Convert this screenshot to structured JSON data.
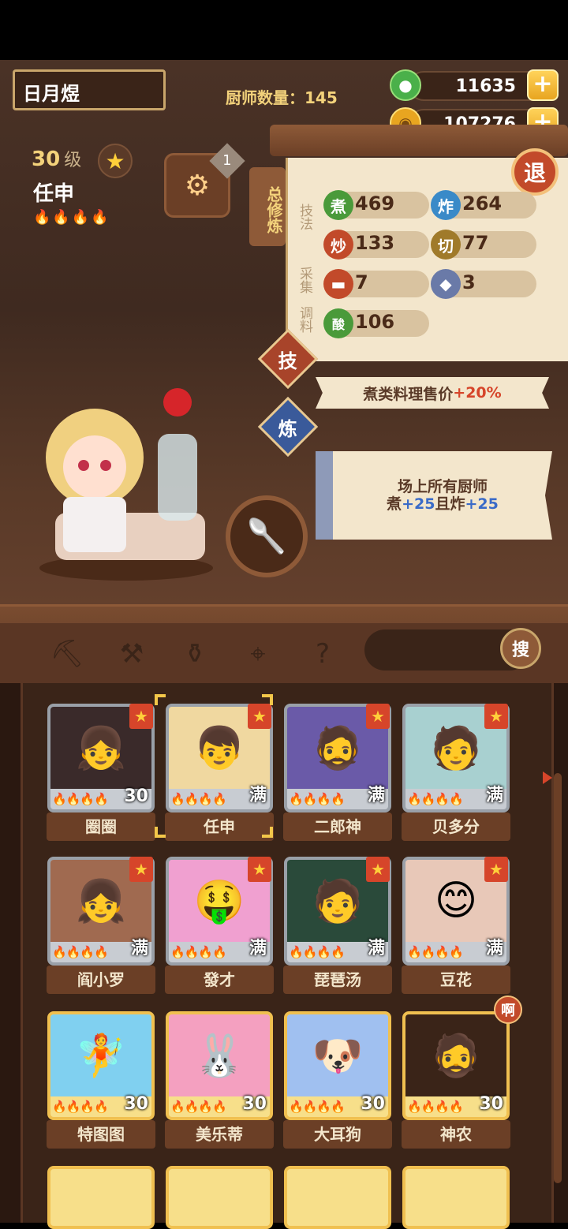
{
  "header": {
    "player_name": "日月煜",
    "chef_count_label": "厨师数量：145",
    "currency_jade": "11635",
    "currency_coin": "107276",
    "plus_label": "+"
  },
  "chef": {
    "level": "30",
    "level_suffix": "级",
    "name": "任申",
    "flames": "🔥🔥🔥🔥"
  },
  "equip": {
    "badge": "1"
  },
  "panel": {
    "tab_label": "总修炼",
    "retreat_label": "退",
    "side_labels": {
      "technique": "技法",
      "gather": "采集",
      "season": "调料"
    },
    "stats": [
      {
        "icon": "煮",
        "value": "469",
        "color": "#4a9a3a"
      },
      {
        "icon": "炸",
        "value": "264",
        "color": "#3a8ac8"
      },
      {
        "icon": "炒",
        "value": "133",
        "color": "#c24a2a"
      },
      {
        "icon": "切",
        "value": "77",
        "color": "#a07a2a"
      },
      {
        "icon": "肉",
        "value": "7",
        "color": "#c24a2a"
      },
      {
        "icon": "鱼",
        "value": "3",
        "color": "#6a7aa8"
      },
      {
        "icon": "酸",
        "value": "106",
        "color": "#4a9a3a"
      }
    ]
  },
  "skill": {
    "button_label": "技",
    "banner_prefix": "煮类料理售价",
    "banner_value": "+20%"
  },
  "refine": {
    "button_label": "炼",
    "line1": "场上所有厨师",
    "line2_a": "煮",
    "line2_b": "+25",
    "line2_c": "且炸",
    "line2_d": "+25"
  },
  "search": {
    "button_label": "搜"
  },
  "filter_icons": [
    "shovel-icon",
    "shovel-alt-icon",
    "jar-icon",
    "location-icon",
    "map-question-icon"
  ],
  "roster": [
    {
      "name": "圈圈",
      "level": "30",
      "face": "👧",
      "gold": false
    },
    {
      "name": "任申",
      "level": "满",
      "face": "👦",
      "gold": false,
      "selected": true
    },
    {
      "name": "二郎神",
      "level": "满",
      "face": "🧔",
      "gold": false
    },
    {
      "name": "贝多分",
      "level": "满",
      "face": "🧑",
      "gold": false
    },
    {
      "name": "阎小罗",
      "level": "满",
      "face": "👧",
      "gold": false
    },
    {
      "name": "發才",
      "level": "满",
      "face": "🤑",
      "gold": false
    },
    {
      "name": "琵琶汤",
      "level": "满",
      "face": "🧑",
      "gold": false
    },
    {
      "name": "豆花",
      "level": "满",
      "face": "😊",
      "gold": false
    },
    {
      "name": "特图图",
      "level": "30",
      "face": "🧚",
      "gold": true
    },
    {
      "name": "美乐蒂",
      "level": "30",
      "face": "🐰",
      "gold": true
    },
    {
      "name": "大耳狗",
      "level": "30",
      "face": "🐶",
      "gold": true
    },
    {
      "name": "神农",
      "level": "30",
      "face": "🧔",
      "gold": true
    }
  ],
  "ah_badge": "啊",
  "colors": {
    "accent": "#f3c74a",
    "panel": "#f3e6cc",
    "wood": "#6b3f26"
  }
}
